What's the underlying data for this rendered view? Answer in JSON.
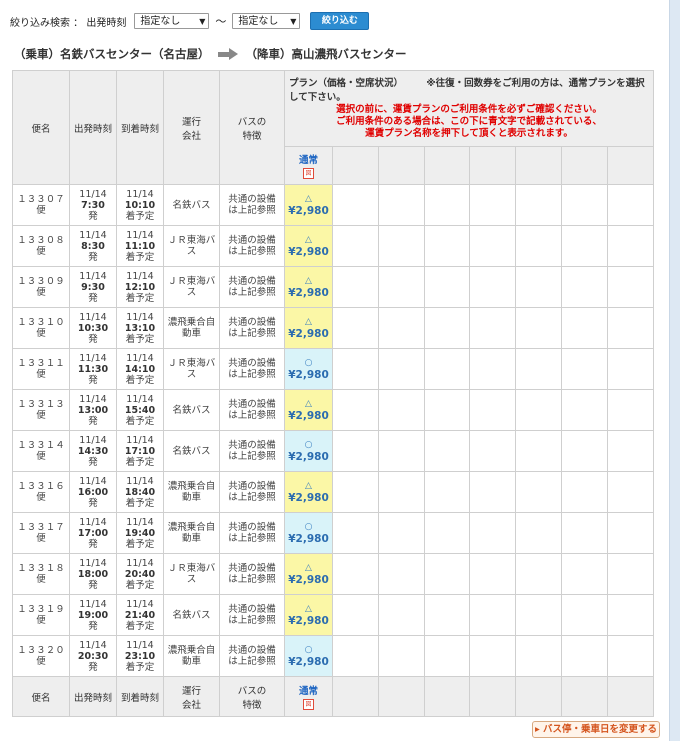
{
  "filter": {
    "label": "絞り込み検索 ： 出発時刻",
    "from_value": "指定なし",
    "to_value": "指定なし",
    "tilde": "～",
    "arrow": "▼",
    "button": "絞り込む"
  },
  "route": {
    "board": "（乗車）名鉄バスセンター（名古屋）",
    "alight": "（降車）高山濃飛バスセンター"
  },
  "headers": {
    "bin": "便名",
    "dep": "出発時刻",
    "arr": "到着時刻",
    "company_1": "運行",
    "company_2": "会社",
    "bus_1": "バスの",
    "bus_2": "特徴",
    "plan_title": "プラン（価格・空席状況）",
    "plan_note": "※往復・回数券をご利用の方は、通常プランを選択して下さい。",
    "plan_warn_1": "選択の前に、運賃プランのご利用条件を必ずご確認ください。",
    "plan_warn_2": "ご利用条件のある場合は、この下に青文字で記載されている、",
    "plan_warn_3": "運賃プラン名称を押下して頂くと表示されます。",
    "plan_name": "通常",
    "plan_icon": "図"
  },
  "rows": [
    {
      "bin": "１３３０７",
      "bin2": "便",
      "dep_date": "11/14",
      "dep_time": "7:30",
      "dep_suffix": "発",
      "arr_date": "11/14",
      "arr_time": "10:10",
      "arr_suffix": "着予定",
      "company": "名鉄バス",
      "feature": "共通の設備は上記参照",
      "seat": "△",
      "price": "¥2,980",
      "status": "tri"
    },
    {
      "bin": "１３３０８",
      "bin2": "便",
      "dep_date": "11/14",
      "dep_time": "8:30",
      "dep_suffix": "発",
      "arr_date": "11/14",
      "arr_time": "11:10",
      "arr_suffix": "着予定",
      "company": "ＪＲ東海バス",
      "feature": "共通の設備は上記参照",
      "seat": "△",
      "price": "¥2,980",
      "status": "tri"
    },
    {
      "bin": "１３３０９",
      "bin2": "便",
      "dep_date": "11/14",
      "dep_time": "9:30",
      "dep_suffix": "発",
      "arr_date": "11/14",
      "arr_time": "12:10",
      "arr_suffix": "着予定",
      "company": "ＪＲ東海バス",
      "feature": "共通の設備は上記参照",
      "seat": "△",
      "price": "¥2,980",
      "status": "tri"
    },
    {
      "bin": "１３３１０",
      "bin2": "便",
      "dep_date": "11/14",
      "dep_time": "10:30",
      "dep_suffix": "発",
      "arr_date": "11/14",
      "arr_time": "13:10",
      "arr_suffix": "着予定",
      "company": "濃飛乗合自動車",
      "feature": "共通の設備は上記参照",
      "seat": "△",
      "price": "¥2,980",
      "status": "tri"
    },
    {
      "bin": "１３３１１",
      "bin2": "便",
      "dep_date": "11/14",
      "dep_time": "11:30",
      "dep_suffix": "発",
      "arr_date": "11/14",
      "arr_time": "14:10",
      "arr_suffix": "着予定",
      "company": "ＪＲ東海バス",
      "feature": "共通の設備は上記参照",
      "seat": "○",
      "price": "¥2,980",
      "status": "ok"
    },
    {
      "bin": "１３３１３",
      "bin2": "便",
      "dep_date": "11/14",
      "dep_time": "13:00",
      "dep_suffix": "発",
      "arr_date": "11/14",
      "arr_time": "15:40",
      "arr_suffix": "着予定",
      "company": "名鉄バス",
      "feature": "共通の設備は上記参照",
      "seat": "△",
      "price": "¥2,980",
      "status": "tri"
    },
    {
      "bin": "１３３１４",
      "bin2": "便",
      "dep_date": "11/14",
      "dep_time": "14:30",
      "dep_suffix": "発",
      "arr_date": "11/14",
      "arr_time": "17:10",
      "arr_suffix": "着予定",
      "company": "名鉄バス",
      "feature": "共通の設備は上記参照",
      "seat": "○",
      "price": "¥2,980",
      "status": "ok"
    },
    {
      "bin": "１３３１６",
      "bin2": "便",
      "dep_date": "11/14",
      "dep_time": "16:00",
      "dep_suffix": "発",
      "arr_date": "11/14",
      "arr_time": "18:40",
      "arr_suffix": "着予定",
      "company": "濃飛乗合自動車",
      "feature": "共通の設備は上記参照",
      "seat": "△",
      "price": "¥2,980",
      "status": "tri"
    },
    {
      "bin": "１３３１７",
      "bin2": "便",
      "dep_date": "11/14",
      "dep_time": "17:00",
      "dep_suffix": "発",
      "arr_date": "11/14",
      "arr_time": "19:40",
      "arr_suffix": "着予定",
      "company": "濃飛乗合自動車",
      "feature": "共通の設備は上記参照",
      "seat": "○",
      "price": "¥2,980",
      "status": "ok"
    },
    {
      "bin": "１３３１８",
      "bin2": "便",
      "dep_date": "11/14",
      "dep_time": "18:00",
      "dep_suffix": "発",
      "arr_date": "11/14",
      "arr_time": "20:40",
      "arr_suffix": "着予定",
      "company": "ＪＲ東海バス",
      "feature": "共通の設備は上記参照",
      "seat": "△",
      "price": "¥2,980",
      "status": "tri"
    },
    {
      "bin": "１３３１９",
      "bin2": "便",
      "dep_date": "11/14",
      "dep_time": "19:00",
      "dep_suffix": "発",
      "arr_date": "11/14",
      "arr_time": "21:40",
      "arr_suffix": "着予定",
      "company": "名鉄バス",
      "feature": "共通の設備は上記参照",
      "seat": "△",
      "price": "¥2,980",
      "status": "tri"
    },
    {
      "bin": "１３３２０",
      "bin2": "便",
      "dep_date": "11/14",
      "dep_time": "20:30",
      "dep_suffix": "発",
      "arr_date": "11/14",
      "arr_time": "23:10",
      "arr_suffix": "着予定",
      "company": "濃飛乗合自動車",
      "feature": "共通の設備は上記参照",
      "seat": "○",
      "price": "¥2,980",
      "status": "ok"
    }
  ],
  "change_button": "バス停・乗車日を変更する"
}
